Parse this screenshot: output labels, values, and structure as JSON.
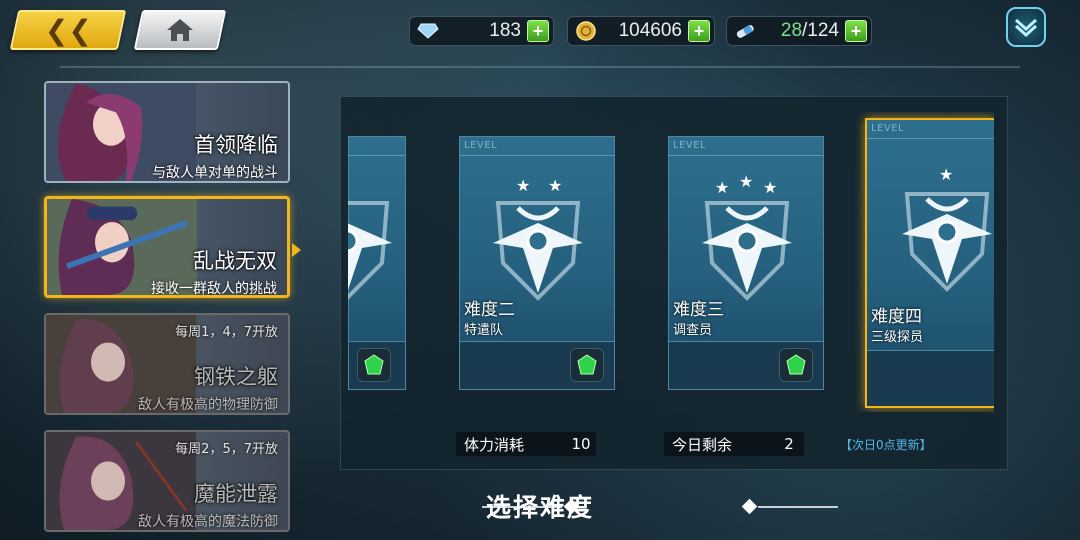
{
  "resources": {
    "diamonds": "183",
    "gold": "104606",
    "stamina_current": "28",
    "stamina_max": "/124"
  },
  "modes": [
    {
      "title": "首领降临",
      "desc": "与敌人单对单的战斗",
      "schedule": ""
    },
    {
      "title": "乱战无双",
      "desc": "接收一群敌人的挑战",
      "schedule": ""
    },
    {
      "title": "钢铁之躯",
      "desc": "敌人有极高的物理防御",
      "schedule": "每周1，4，7开放"
    },
    {
      "title": "魔能泄露",
      "desc": "敌人有极高的魔法防御",
      "schedule": "每周2，5，7开放"
    }
  ],
  "cards": [
    {
      "level": "LEVEL",
      "name": "难度二",
      "sub": "特遣队",
      "stars": 2
    },
    {
      "level": "LEVEL",
      "name": "难度三",
      "sub": "调查员",
      "stars": 3
    },
    {
      "level": "LEVEL",
      "name": "难度四",
      "sub": "三级探员",
      "stars": 1
    }
  ],
  "stats": {
    "stamina_cost_label": "体力消耗",
    "stamina_cost_value": "10",
    "remaining_label": "今日剩余",
    "remaining_value": "2",
    "refresh_note": "【次日0点更新】"
  },
  "select_title": "选择难度",
  "colors": {
    "accent_gold": "#f3b51a",
    "card_blue": "#2e6f8e",
    "plus_green": "#3d9e1d"
  }
}
